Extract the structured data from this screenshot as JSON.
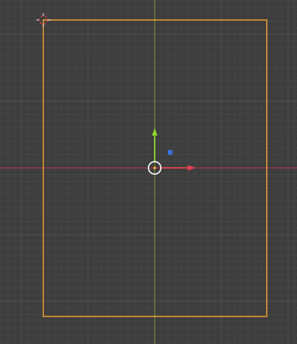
{
  "viewport": {
    "background_color": "#3d3d3d",
    "grid_minor_color": "#474747",
    "grid_major_color": "#545454",
    "x_axis_color": "#c83a4e",
    "y_axis_color": "#7ea23a",
    "selection_outline_color": "#f0a030"
  },
  "gizmo": {
    "x_arrow_color": "#e6404f",
    "y_arrow_color": "#8cd42a",
    "z_handle_color": "#3c6fd8",
    "center_ring_color": "#ffffff",
    "origin_dot_color": "#f0a030"
  },
  "cursor": {
    "icon": "3d-cursor-icon",
    "ring_color_a": "#ffffff",
    "ring_color_b": "#e64040"
  },
  "icons": {
    "move_gizmo": "move-gizmo-icon",
    "cursor": "3d-cursor-icon"
  }
}
